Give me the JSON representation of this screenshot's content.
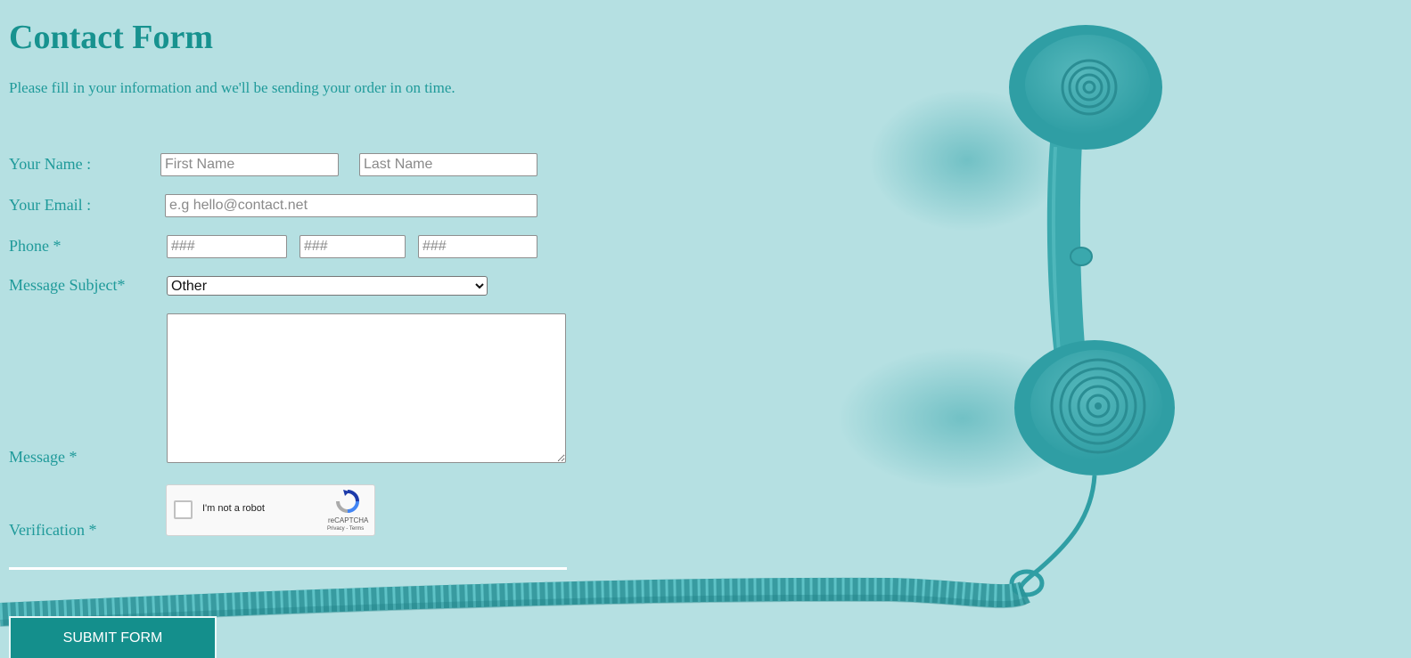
{
  "page": {
    "title": "Contact Form",
    "intro": "Please fill in your information and we'll be sending your order in on time."
  },
  "colors": {
    "background": "#b5e0e2",
    "accent": "#17928f",
    "text": "#1f9a9a",
    "button": "#148f8c",
    "phone": "#3aa8ad"
  },
  "form": {
    "name": {
      "label": "Your Name :",
      "first_placeholder": "First Name",
      "last_placeholder": "Last Name"
    },
    "email": {
      "label": "Your Email :",
      "placeholder": "e.g hello@contact.net"
    },
    "phone": {
      "label": "Phone *",
      "part1_placeholder": "###",
      "part2_placeholder": "###",
      "part3_placeholder": "###"
    },
    "subject": {
      "label": "Message Subject*",
      "selected": "Other"
    },
    "message": {
      "label": "Message *"
    },
    "verification": {
      "label": "Verification *",
      "checkbox_label": "I'm not a robot",
      "brand": "reCAPTCHA",
      "privacy": "Privacy",
      "separator": " - ",
      "terms": "Terms"
    },
    "submit_label": "SUBMIT FORM"
  },
  "icons": {
    "captcha_logo": "recaptcha-logo-icon",
    "select_arrow": "chevron-down-icon",
    "background_art": "telephone-handset-icon"
  }
}
